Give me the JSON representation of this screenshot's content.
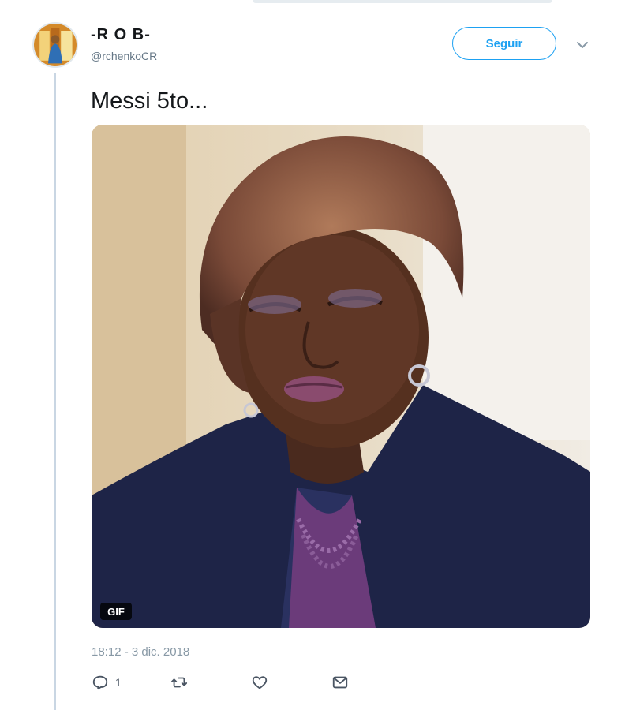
{
  "tweet": {
    "author": {
      "display_name": "-R O B-",
      "handle": "@rchenkoCR",
      "avatar_icon": "profile-avatar"
    },
    "follow_label": "Seguir",
    "text": "Messi 5to...",
    "media": {
      "type": "gif",
      "badge": "GIF",
      "description_icon": "woman-eyes-closed-gif"
    },
    "timestamp": "18:12 - 3 dic. 2018",
    "actions": {
      "reply_count": "1",
      "reply_icon": "reply-icon",
      "retweet_icon": "retweet-icon",
      "like_icon": "heart-icon",
      "dm_icon": "envelope-icon"
    }
  },
  "colors": {
    "accent": "#1da1f2",
    "muted": "#657786",
    "thread_line": "#c9d6e3"
  }
}
